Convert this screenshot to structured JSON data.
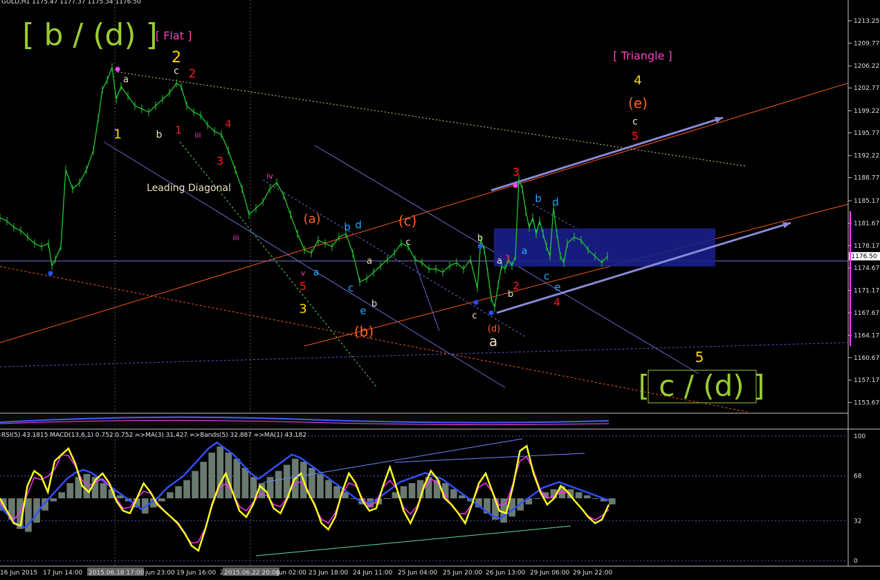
{
  "header": {
    "symbol_text": "GOLD,H1  1175.47 1177.37 1175.34 1176.50"
  },
  "indicator_header": {
    "text": "RSI(5) 43.1815   MACD(13,6,1) 0.752 0.752   =>MA(3) 31.427   =>Bands(5) 32.887   =>MA(1) 43.182"
  },
  "colors": {
    "background": "#000000",
    "grid": "#5a5a5a",
    "bull_candle": "#22c832",
    "bear_candle": "#22c832",
    "price_line": "#9aa0d0",
    "rsi_line": "#ffff20",
    "ma_line": "#ff30ff",
    "bands_line": "#3050ff",
    "macd_hist": "#6a7a70",
    "label_green": "#9acd32",
    "label_yellow": "#ffd700",
    "label_red": "#ff2020",
    "label_orange": "#ff6020",
    "label_cyan": "#20a8ff",
    "label_white": "#f0e0c0",
    "label_magenta": "#ff40c0",
    "box_fill": "#1a1f8a"
  },
  "chart_data": {
    "type": "line",
    "title": "GOLD,H1",
    "price_axis": {
      "ticks": [
        1213.25,
        1209.77,
        1206.22,
        1202.77,
        1199.22,
        1195.77,
        1192.22,
        1188.77,
        1185.17,
        1181.67,
        1178.17,
        1174.67,
        1171.17,
        1167.67,
        1164.17,
        1160.67,
        1157.17,
        1153.67
      ],
      "current_price": "1176.50",
      "ylim": [
        1152.0,
        1216.5
      ]
    },
    "time_axis": {
      "ticks": [
        "16 Jun 2015",
        "17 Jun 14:00",
        "2015.06.18 17:00",
        "jun 23:00",
        "19 Jun 16:00",
        "2",
        "2015.06.22 20:00",
        "Jun 02:00",
        "23 Jun 18:00",
        "24 Jun 11:00",
        "25 Jun 04:00",
        "25 Jun 20:00",
        "26 Jun 13:00",
        "29 Jun 06:00",
        "29 Jun 22:00"
      ]
    },
    "price_series": {
      "name": "GOLD H1",
      "x": [
        0,
        10,
        20,
        30,
        40,
        50,
        60,
        70,
        75,
        80,
        88,
        95,
        105,
        115,
        125,
        135,
        142,
        148,
        155,
        162,
        168,
        175,
        185,
        195,
        205,
        215,
        225,
        235,
        245,
        255,
        262,
        270,
        280,
        290,
        300,
        310,
        320,
        330,
        340,
        350,
        360,
        370,
        380,
        390,
        400,
        410,
        420,
        430,
        440,
        450,
        460,
        470,
        480,
        490,
        500,
        510,
        520,
        530,
        540,
        550,
        560,
        570,
        580,
        590,
        600,
        610,
        620,
        630,
        640,
        650,
        660,
        670,
        680,
        690,
        695,
        700,
        705,
        710,
        715,
        720,
        725,
        730,
        735,
        740,
        745,
        750,
        755,
        760,
        765,
        770,
        775,
        780,
        785,
        790,
        795,
        800,
        805,
        810,
        815,
        820,
        830,
        840,
        850,
        860,
        870,
        878
      ],
      "y": [
        1182.5,
        1182.0,
        1181.0,
        1180.5,
        1179.5,
        1178.5,
        1178.0,
        1178.5,
        1175.0,
        1176.0,
        1178.0,
        1190.0,
        1187.0,
        1188.0,
        1190.0,
        1193.0,
        1198.0,
        1202.5,
        1204.0,
        1206.0,
        1201.0,
        1203.0,
        1201.5,
        1200.0,
        1199.5,
        1199.0,
        1200.0,
        1201.0,
        1202.0,
        1203.5,
        1203.0,
        1200.0,
        1199.0,
        1198.5,
        1197.0,
        1196.0,
        1195.5,
        1193.0,
        1190.0,
        1187.0,
        1183.0,
        1184.0,
        1185.0,
        1187.0,
        1188.0,
        1186.0,
        1183.0,
        1180.0,
        1177.5,
        1177.0,
        1179.0,
        1178.5,
        1178.0,
        1179.5,
        1180.0,
        1177.0,
        1172.5,
        1173.0,
        1174.0,
        1175.0,
        1176.0,
        1177.0,
        1178.5,
        1178.0,
        1176.0,
        1175.5,
        1174.5,
        1174.5,
        1174.0,
        1175.0,
        1175.5,
        1174.5,
        1176.0,
        1171.5,
        1179.0,
        1177.5,
        1174.0,
        1170.0,
        1168.5,
        1172.0,
        1175.0,
        1174.5,
        1176.0,
        1175.0,
        1176.5,
        1188.5,
        1187.0,
        1183.5,
        1181.0,
        1182.5,
        1180.0,
        1182.0,
        1180.0,
        1178.0,
        1176.5,
        1184.0,
        1180.0,
        1176.5,
        1175.5,
        1178.5,
        1179.5,
        1179.0,
        1177.5,
        1176.5,
        1175.5,
        1176.5
      ]
    },
    "macd_oscillator": {
      "name": "MACD histogram",
      "y": [
        -8,
        -14,
        -20,
        -22,
        -16,
        -8,
        -2,
        4,
        10,
        14,
        16,
        14,
        10,
        6,
        2,
        -2,
        -6,
        -10,
        -6,
        -2,
        4,
        8,
        12,
        18,
        24,
        30,
        34,
        30,
        26,
        20,
        14,
        10,
        14,
        18,
        22,
        26,
        24,
        20,
        16,
        12,
        8,
        4,
        0,
        -4,
        -6,
        -4,
        0,
        4,
        8,
        10,
        12,
        14,
        12,
        10,
        6,
        2,
        -2,
        -6,
        -10,
        -14,
        -16,
        -12,
        -8,
        -4,
        0,
        4,
        6,
        8,
        6,
        4,
        2,
        0,
        -2,
        -4
      ]
    },
    "rsi_series": {
      "name": "RSI(5)",
      "y": [
        50,
        40,
        30,
        28,
        60,
        72,
        68,
        55,
        80,
        85,
        90,
        78,
        60,
        55,
        65,
        70,
        62,
        48,
        40,
        38,
        50,
        62,
        55,
        45,
        40,
        35,
        30,
        22,
        12,
        8,
        25,
        45,
        60,
        70,
        55,
        40,
        35,
        45,
        60,
        55,
        42,
        38,
        50,
        65,
        70,
        55,
        45,
        30,
        25,
        35,
        55,
        70,
        62,
        48,
        40,
        42,
        60,
        75,
        58,
        40,
        30,
        42,
        60,
        72,
        65,
        50,
        45,
        38,
        30,
        45,
        62,
        70,
        55,
        40,
        38,
        60,
        88,
        92,
        70,
        55,
        45,
        50,
        60,
        55,
        48,
        42,
        35,
        30,
        33,
        45
      ]
    },
    "rsi_levels": [
      100,
      68,
      32,
      0
    ],
    "elliott_labels": [
      {
        "text": "[ b / (d) ]",
        "color": "label_green"
      },
      {
        "text": "[ Flat ]",
        "color": "label_magenta"
      },
      {
        "text": "[ Triangle ]",
        "color": "label_magenta"
      },
      {
        "text": "[ c / (d) ]",
        "color": "label_green"
      },
      {
        "text": "Leading Diagonal",
        "color": "label_white"
      }
    ],
    "wave_labels": [
      {
        "t": "2",
        "c": "label_yellow"
      },
      {
        "t": "c",
        "c": "label_white"
      },
      {
        "t": "2",
        "c": "label_red"
      },
      {
        "t": "a",
        "c": "label_white"
      },
      {
        "t": "1",
        "c": "label_yellow"
      },
      {
        "t": "b",
        "c": "label_white"
      },
      {
        "t": "1",
        "c": "label_red"
      },
      {
        "t": "iii",
        "c": "label_magenta"
      },
      {
        "t": "4",
        "c": "label_red"
      },
      {
        "t": "3",
        "c": "label_red"
      },
      {
        "t": "iii",
        "c": "label_magenta"
      },
      {
        "t": "iv",
        "c": "label_magenta"
      },
      {
        "t": "(a)",
        "c": "label_orange"
      },
      {
        "t": "v",
        "c": "label_magenta"
      },
      {
        "t": "5",
        "c": "label_red"
      },
      {
        "t": "3",
        "c": "label_yellow"
      },
      {
        "t": "a",
        "c": "label_cyan"
      },
      {
        "t": "b",
        "c": "label_cyan"
      },
      {
        "t": "d",
        "c": "label_cyan"
      },
      {
        "t": "c",
        "c": "label_cyan"
      },
      {
        "t": "e",
        "c": "label_cyan"
      },
      {
        "t": "a",
        "c": "label_white"
      },
      {
        "t": "b",
        "c": "label_white"
      },
      {
        "t": "(b)",
        "c": "label_orange"
      },
      {
        "t": "(c)",
        "c": "label_orange"
      },
      {
        "t": "c",
        "c": "label_white"
      },
      {
        "t": "b",
        "c": "label_white"
      },
      {
        "t": "a",
        "c": "label_white"
      },
      {
        "t": "c",
        "c": "label_white"
      },
      {
        "t": "(d)",
        "c": "label_orange"
      },
      {
        "t": "a",
        "c": "label_white"
      },
      {
        "t": "1",
        "c": "label_red"
      },
      {
        "t": "b",
        "c": "label_white"
      },
      {
        "t": "2",
        "c": "label_red"
      },
      {
        "t": "3",
        "c": "label_red"
      },
      {
        "t": "b",
        "c": "label_cyan"
      },
      {
        "t": "d",
        "c": "label_cyan"
      },
      {
        "t": "a",
        "c": "label_cyan"
      },
      {
        "t": "c",
        "c": "label_cyan"
      },
      {
        "t": "e",
        "c": "label_cyan"
      },
      {
        "t": "4",
        "c": "label_red"
      },
      {
        "t": "4",
        "c": "label_yellow"
      },
      {
        "t": "(e)",
        "c": "label_orange"
      },
      {
        "t": "c",
        "c": "label_white"
      },
      {
        "t": "5",
        "c": "label_red"
      },
      {
        "t": "5",
        "c": "label_yellow"
      }
    ]
  }
}
